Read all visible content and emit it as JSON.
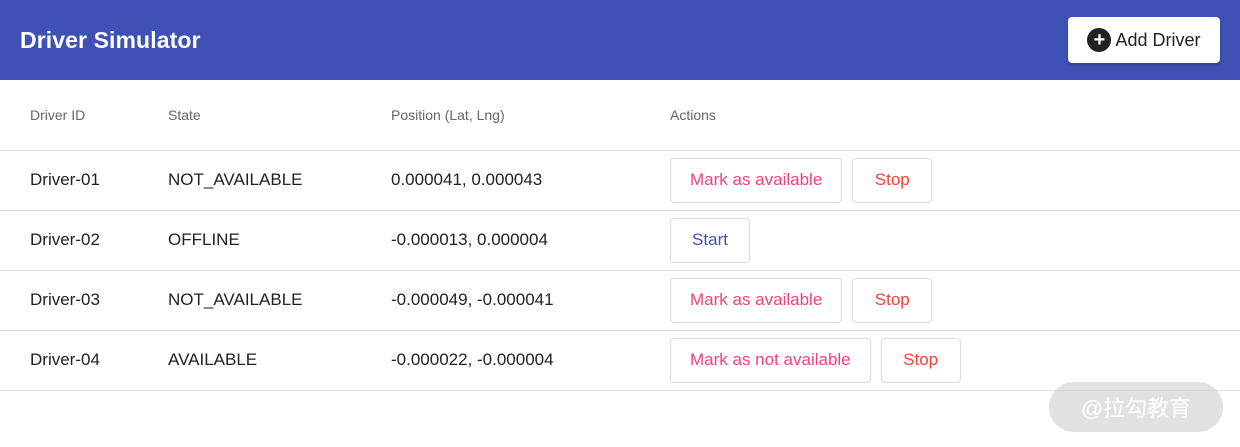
{
  "app": {
    "title": "Driver Simulator",
    "add_driver_label": "Add Driver",
    "primary_color": "#3f51b5"
  },
  "table": {
    "headers": [
      "Driver ID",
      "State",
      "Position (Lat, Lng)",
      "Actions"
    ],
    "rows": [
      {
        "id": "Driver-01",
        "state": "NOT_AVAILABLE",
        "position": "0.000041, 0.000043",
        "actions": [
          "Mark as available",
          "Stop"
        ]
      },
      {
        "id": "Driver-02",
        "state": "OFFLINE",
        "position": "-0.000013, 0.000004",
        "actions": [
          "Start"
        ]
      },
      {
        "id": "Driver-03",
        "state": "NOT_AVAILABLE",
        "position": "-0.000049, -0.000041",
        "actions": [
          "Mark as available",
          "Stop"
        ]
      },
      {
        "id": "Driver-04",
        "state": "AVAILABLE",
        "position": "-0.000022, -0.000004",
        "actions": [
          "Mark as not available",
          "Stop"
        ]
      }
    ]
  },
  "colors": {
    "mark_action": "#f0437a",
    "stop_action": "#f44336",
    "start_action": "#3f51b5"
  },
  "watermark": "@拉勾教育"
}
